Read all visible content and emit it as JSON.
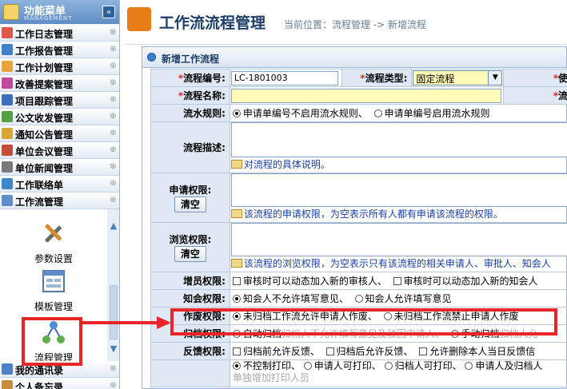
{
  "sidebar": {
    "title": "功能菜单",
    "subtitle": "MANAGEMENT",
    "collapse_icon": "double-chevron-left",
    "items": [
      {
        "label": "工作日志管理",
        "icon": "calendar-icon",
        "color": "#e0584a"
      },
      {
        "label": "工作报告管理",
        "icon": "report-icon",
        "color": "#3f80c6"
      },
      {
        "label": "工作计划管理",
        "icon": "plan-icon",
        "color": "#e8a43a"
      },
      {
        "label": "改善提案管理",
        "icon": "proposal-icon",
        "color": "#c04a9a"
      },
      {
        "label": "项目跟踪管理",
        "icon": "project-icon",
        "color": "#3b6fbd"
      },
      {
        "label": "公文收发管理",
        "icon": "document-icon",
        "color": "#54a047"
      },
      {
        "label": "通知公告管理",
        "icon": "notice-icon",
        "color": "#d7a634"
      },
      {
        "label": "单位会议管理",
        "icon": "meeting-icon",
        "color": "#c14d3a"
      },
      {
        "label": "单位新闻管理",
        "icon": "news-icon",
        "color": "#7a7a7a"
      },
      {
        "label": "工作联络单",
        "icon": "contact-icon",
        "color": "#3d86c7"
      },
      {
        "label": "工作流管理",
        "icon": "workflow-icon",
        "color": "#5d8fcc"
      }
    ],
    "sub_items": [
      {
        "label": "参数设置",
        "icon": "tools-icon"
      },
      {
        "label": "模板管理",
        "icon": "template-icon"
      },
      {
        "label": "流程管理",
        "icon": "flow-icon"
      }
    ],
    "bottom_items": [
      {
        "label": "我的通讯录",
        "icon": "addressbook-icon"
      },
      {
        "label": "个人备忘录",
        "icon": "memo-icon"
      }
    ]
  },
  "header": {
    "title": "工作流流程管理",
    "breadcrumb": "当前位置：流程管理 -> 新增流程"
  },
  "panel": {
    "title": "新增工作流程"
  },
  "form": {
    "flow_no_label": "流程编号:",
    "flow_no_value": "LC-1801003",
    "flow_type_label": "流程类型:",
    "flow_type_value": "固定流程",
    "use_label": "使用",
    "flow_name_label": "流程名称:",
    "flow_name_right_label": "流程",
    "serial_rule_label": "流水规则:",
    "serial_rule_opt1": "申请单编号不启用流水规则、",
    "serial_rule_opt2": "申请单编号启用流水规则",
    "desc_label": "流程描述:",
    "desc_hint": "对流程的具体说明。",
    "apply_perm_label": "申请权限:",
    "clear_btn": "清空",
    "apply_perm_hint": "该流程的申请权限，为空表示所有人都有申请该流程的权限。",
    "browse_perm_label": "浏览权限:",
    "browse_perm_hint": "该流程的浏览权限，为空表示只有该流程的相关申请人、审批人、知会人",
    "add_staff_label": "增员权限:",
    "add_staff_opt1": "审核时可以动态加入新的审核人、",
    "add_staff_opt2": "审核时可以动态加入新的知会人",
    "notify_label": "知会权限:",
    "notify_opt1": "知会人不允许填写意见、",
    "notify_opt2": "知会人允许填写意见",
    "void_label": "作废权限:",
    "void_opt1": "未归档工作流允许申请人作废、",
    "void_opt2": "未归档工作流禁止申请人作废",
    "archive_label": "归档权限:",
    "archive_opt1": "自动归档",
    "archive_opt1_note": "归档人不允许填写意见及驳回申请人、",
    "archive_opt2": "手动归档",
    "archive_opt2_note": "归档人允",
    "feedback_label": "反馈权限:",
    "feedback_opt1": "归档前允许反馈、",
    "feedback_opt2": "归档后允许反馈、",
    "feedback_opt3": "允许删除本人当日反馈信",
    "print_opt1": "不控制打印、",
    "print_opt2": "申请人可打印、",
    "print_opt3": "归档人可打印、",
    "print_opt4": "申请人及归档人",
    "print_extra": "单独增加打印人员"
  }
}
